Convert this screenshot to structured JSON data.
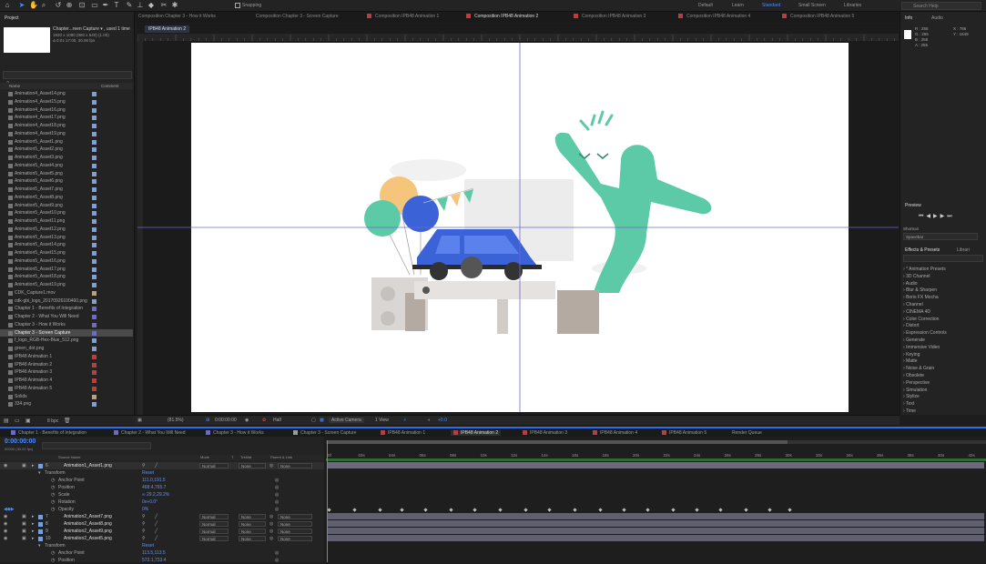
{
  "toolbar": {
    "snapping": "Snapping",
    "workspaces": [
      "Default",
      "Learn",
      "Standard",
      "Small Screen",
      "Libraries"
    ],
    "search_placeholder": "Search Help"
  },
  "comp_tabs": [
    {
      "label": "Composition Chapter 3 - How it Works",
      "color": "#9a9a9a"
    },
    {
      "label": "Composition Chapter 3 - Screen Capture",
      "color": "#9a9a9a"
    },
    {
      "label": "Composition IPB48 Animation 1",
      "color": "#c23a3a"
    },
    {
      "label": "Composition IPB48 Animation 2",
      "color": "#c23a3a"
    },
    {
      "label": "Composition IPB48 Animation 3",
      "color": "#c23a3a"
    },
    {
      "label": "Composition IPB48 Animation 4",
      "color": "#c23a3a"
    },
    {
      "label": "Composition IPB48 Animation 5",
      "color": "#c23a3a"
    }
  ],
  "viewer_sub_tab": "IPB48 Animation 2",
  "project": {
    "title": "Project",
    "selected_name": "Chapter...reen Capture ▾ , used 1 time",
    "selected_info1": "1920 x 1080 (960 x 540) (1.00)",
    "selected_info2": "Δ 0:01:17:00, 30.00 fps",
    "col_name": "Name",
    "col_comment": "Comment",
    "items": [
      {
        "label": "Animation4_Asset14.png",
        "tag": "#7b9fd6"
      },
      {
        "label": "Animation4_Asset15.png",
        "tag": "#7b9fd6"
      },
      {
        "label": "Animation4_Asset16.png",
        "tag": "#7b9fd6"
      },
      {
        "label": "Animation4_Asset17.png",
        "tag": "#7b9fd6"
      },
      {
        "label": "Animation4_Asset18.png",
        "tag": "#7b9fd6"
      },
      {
        "label": "Animation4_Asset19.png",
        "tag": "#7b9fd6"
      },
      {
        "label": "Animation5_Asset1.png",
        "tag": "#7b9fd6"
      },
      {
        "label": "Animation5_Asset2.png",
        "tag": "#7b9fd6"
      },
      {
        "label": "Animation5_Asset3.png",
        "tag": "#7b9fd6"
      },
      {
        "label": "Animation5_Asset4.png",
        "tag": "#7b9fd6"
      },
      {
        "label": "Animation5_Asset5.png",
        "tag": "#7b9fd6"
      },
      {
        "label": "Animation5_Asset6.png",
        "tag": "#7b9fd6"
      },
      {
        "label": "Animation5_Asset7.png",
        "tag": "#7b9fd6"
      },
      {
        "label": "Animation5_Asset8.png",
        "tag": "#7b9fd6"
      },
      {
        "label": "Animation5_Asset9.png",
        "tag": "#7b9fd6"
      },
      {
        "label": "Animation5_Asset10.png",
        "tag": "#7b9fd6"
      },
      {
        "label": "Animation5_Asset11.png",
        "tag": "#7b9fd6"
      },
      {
        "label": "Animation5_Asset12.png",
        "tag": "#7b9fd6"
      },
      {
        "label": "Animation5_Asset13.png",
        "tag": "#7b9fd6"
      },
      {
        "label": "Animation5_Asset14.png",
        "tag": "#7b9fd6"
      },
      {
        "label": "Animation5_Asset15.png",
        "tag": "#7b9fd6"
      },
      {
        "label": "Animation5_Asset16.png",
        "tag": "#7b9fd6"
      },
      {
        "label": "Animation5_Asset17.png",
        "tag": "#7b9fd6"
      },
      {
        "label": "Animation5_Asset18.png",
        "tag": "#7b9fd6"
      },
      {
        "label": "Animation5_Asset19.png",
        "tag": "#7b9fd6"
      },
      {
        "label": "CDK_Capture1.mov",
        "tag": "#b8a080"
      },
      {
        "label": "cdk-gbi_logo_20170926100460.png",
        "tag": "#7b9fd6"
      },
      {
        "label": "Chapter 1 - Benefits of Integration",
        "tag": "#6b6bcf"
      },
      {
        "label": "Chapter 2 - What You Will Need",
        "tag": "#6b6bcf"
      },
      {
        "label": "Chapter 3 - How it Works",
        "tag": "#6b6bcf"
      },
      {
        "label": "Chapter 3 - Screen Capture",
        "tag": "#6b6bcf"
      },
      {
        "label": "f_logo_RGB-Hex-Blue_512.png",
        "tag": "#7b9fd6"
      },
      {
        "label": "green_dot.png",
        "tag": "#7b9fd6"
      },
      {
        "label": "IPB48 Animation 1",
        "tag": "#c23a3a"
      },
      {
        "label": "IPB48 Animation 2",
        "tag": "#c23a3a"
      },
      {
        "label": "IPB48 Animation 3",
        "tag": "#c23a3a"
      },
      {
        "label": "IPB48 Animation 4",
        "tag": "#c23a3a"
      },
      {
        "label": "IPB48 Animation 5",
        "tag": "#c23a3a"
      },
      {
        "label": "Solids",
        "tag": "#b8a080"
      },
      {
        "label": "334.png",
        "tag": "#7b9fd6"
      }
    ],
    "selected_index": 30,
    "footer_bpc": "8 bpc"
  },
  "info": {
    "tab_info": "Info",
    "tab_audio": "Audio",
    "r": "R : 255",
    "g": "G : 255",
    "b": "B : 255",
    "a": "A : 255",
    "x": "X : 786",
    "y": "Y : 1649"
  },
  "preview": {
    "title": "Preview",
    "shortcut_label": "Shortcut",
    "shortcut_value": "Spacebar"
  },
  "effects": {
    "tab": "Effects & Presets",
    "tab2": "Librari",
    "items": [
      "* Animation Presets",
      "3D Channel",
      "Audio",
      "Blur & Sharpen",
      "Boris FX Mocha",
      "Channel",
      "CINEMA 4D",
      "Color Correction",
      "Distort",
      "Expression Controls",
      "Generate",
      "Immersive Video",
      "Keying",
      "Matte",
      "Noise & Grain",
      "Obsolete",
      "Perspective",
      "Simulation",
      "Stylize",
      "Text",
      "Time"
    ]
  },
  "viewer_bar": {
    "zoom": "(81.5%)",
    "time": "0:00:00:00",
    "resolution": "Half",
    "camera": "Active Camera",
    "views": "1 View",
    "offset": "+0.0"
  },
  "timeline_tabs": [
    {
      "label": "Chapter 1 - Benefits of Integration",
      "color": "#6b6bcf"
    },
    {
      "label": "Chapter 2 - What You Will Need",
      "color": "#6b6bcf"
    },
    {
      "label": "Chapter 3 - How it Works",
      "color": "#6b6bcf"
    },
    {
      "label": "Chapter 3 - Screen Capture",
      "color": "#9a9a9a"
    },
    {
      "label": "IPB48 Animation 1",
      "color": "#c23a3a"
    },
    {
      "label": "IPB48 Animation 2",
      "color": "#c23a3a"
    },
    {
      "label": "IPB48 Animation 3",
      "color": "#c23a3a"
    },
    {
      "label": "IPB48 Animation 4",
      "color": "#c23a3a"
    },
    {
      "label": "IPB48 Animation 5",
      "color": "#c23a3a"
    },
    {
      "label": "Render Queue",
      "color": ""
    }
  ],
  "timeline": {
    "timecode": "0:00:00:00",
    "fps": "00000 (30.00 fps)",
    "headers": {
      "source": "Source Name",
      "mode": "Mode",
      "t": "T",
      "trkmat": "TrkMat",
      "parent": "Parent & Link"
    },
    "ruler": [
      "0f",
      "02s",
      "04s",
      "06s",
      "08s",
      "10s",
      "12s",
      "14s",
      "16s",
      "18s",
      "20s",
      "22s",
      "24s",
      "26s",
      "28s",
      "30s",
      "32s",
      "34s",
      "36s",
      "38s",
      "40s",
      "42s"
    ],
    "layer6": {
      "num": "6",
      "name": "Animation1_Asset1.png",
      "mode": "Normal",
      "trkmat": "None",
      "parent": "None"
    },
    "transform": "Transform",
    "reset": "Reset",
    "props6": [
      {
        "name": "Anchor Point",
        "value": "111.0,191.5"
      },
      {
        "name": "Position",
        "value": "468.4,765.7"
      },
      {
        "name": "Scale",
        "value": "∞ 29.2,29.2%"
      },
      {
        "name": "Rotation",
        "value": "0x+0.0°"
      },
      {
        "name": "Opacity",
        "value": "0%"
      }
    ],
    "layers": [
      {
        "num": "7",
        "name": "Animation2_Asset7.png",
        "mode": "Normal",
        "trkmat": "None",
        "parent": "None"
      },
      {
        "num": "8",
        "name": "Animation2_Asset8.png",
        "mode": "Normal",
        "trkmat": "None",
        "parent": "None"
      },
      {
        "num": "9",
        "name": "Animation2_Asset9.png",
        "mode": "Normal",
        "trkmat": "None",
        "parent": "None"
      },
      {
        "num": "10",
        "name": "Animation2_Asset5.png",
        "mode": "Normal",
        "trkmat": "None",
        "parent": "None"
      }
    ],
    "props10": [
      {
        "name": "Anchor Point",
        "value": "113.5,113.5"
      },
      {
        "name": "Position",
        "value": "573.1,733.4"
      }
    ]
  },
  "colors": {
    "accent": "#2a6df0",
    "guide": "#6b6bcf",
    "teal": "#5cc9a7",
    "car": "#3c62d8"
  }
}
